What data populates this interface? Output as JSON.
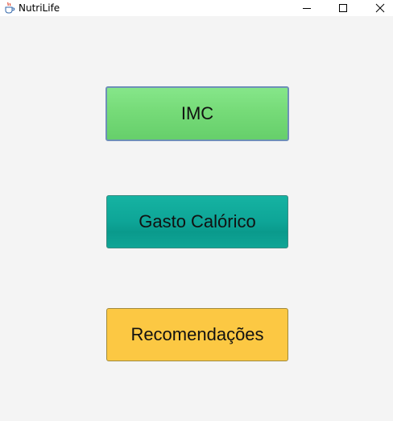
{
  "window": {
    "title": "NutriLife",
    "icon": "java-cup-icon"
  },
  "controls": {
    "minimize": "minimize-icon",
    "maximize": "maximize-icon",
    "close": "close-icon"
  },
  "buttons": {
    "imc": {
      "label": "IMC",
      "color": "#76db78"
    },
    "gasto": {
      "label": "Gasto Calórico",
      "color": "#0ea597"
    },
    "recomendacoes": {
      "label": "Recomendações",
      "color": "#fcc843"
    }
  }
}
